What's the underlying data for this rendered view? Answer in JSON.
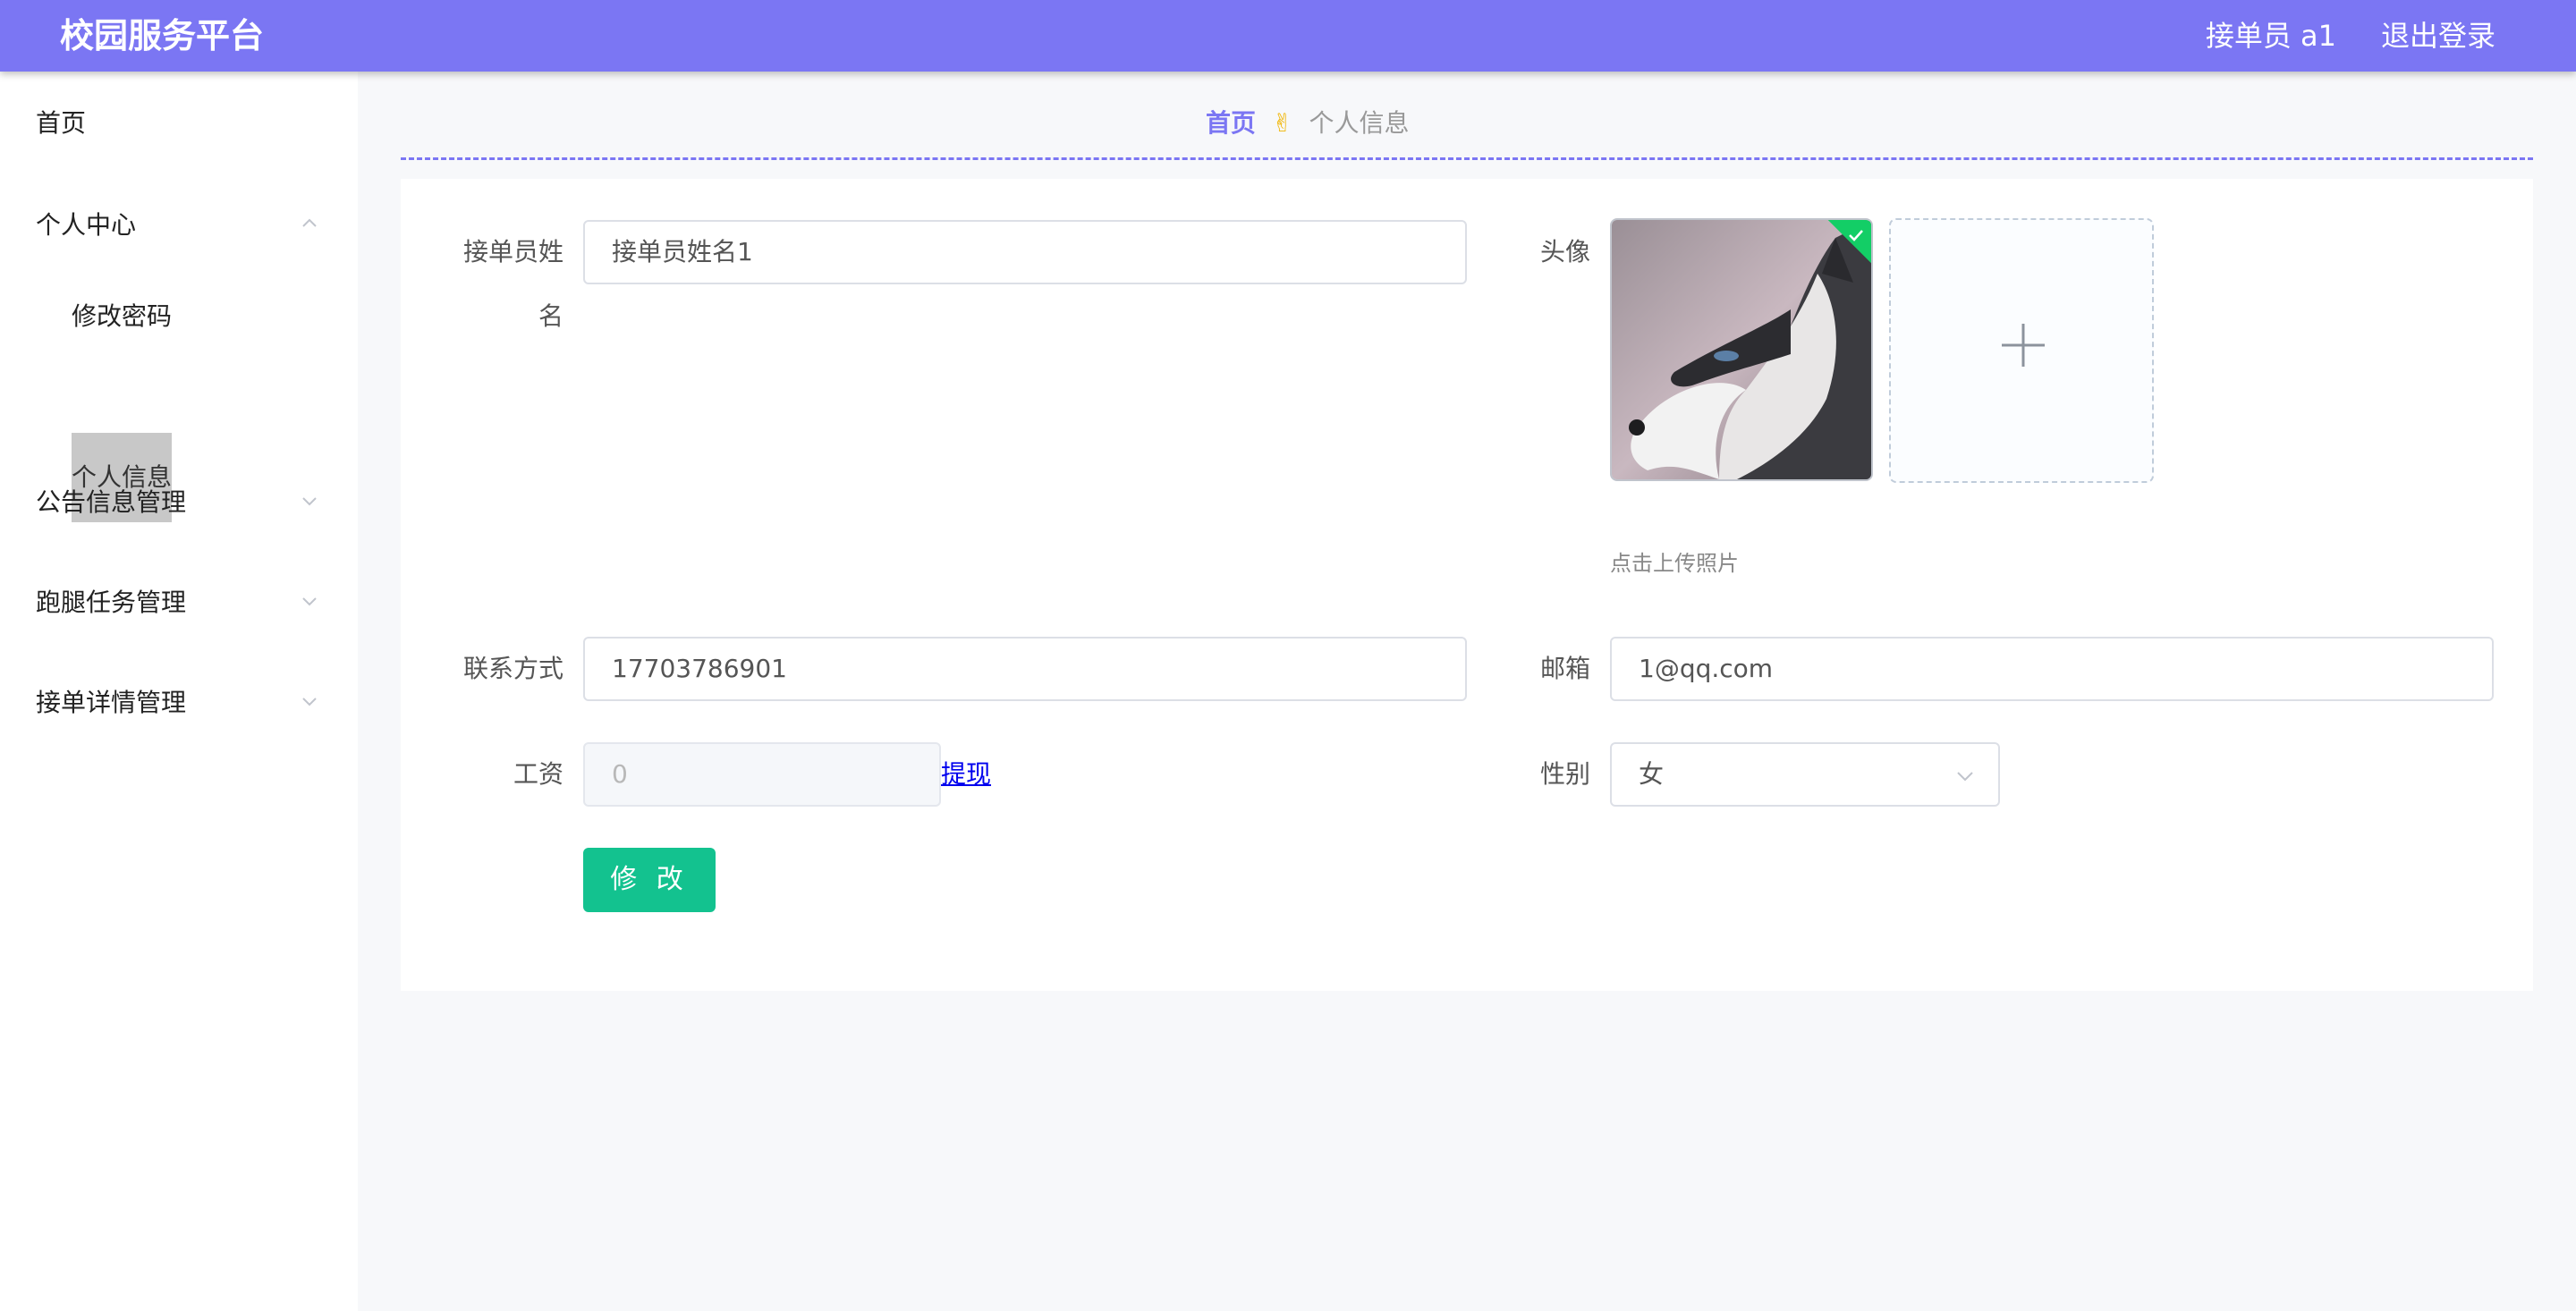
{
  "header": {
    "brand": "校园服务平台",
    "user_label": "接单员 a1",
    "logout_label": "退出登录"
  },
  "sidebar": {
    "home": "首页",
    "personal_center": "个人中心",
    "change_password": "修改密码",
    "personal_info": "个人信息",
    "notice_manage": "公告信息管理",
    "errand_manage": "跑腿任务管理",
    "order_detail_manage": "接单详情管理"
  },
  "breadcrumb": {
    "home": "首页",
    "separator": "✌",
    "current": "个人信息"
  },
  "form": {
    "name_label_line1": "接单员姓",
    "name_label_line2": "名",
    "name_value": "接单员姓名1",
    "avatar_label": "头像",
    "upload_tip": "点击上传照片",
    "contact_label": "联系方式",
    "contact_value": "17703786901",
    "email_label": "邮箱",
    "email_value": "1@qq.com",
    "salary_label": "工资",
    "salary_value": "0",
    "withdraw_label": "提现",
    "gender_label": "性别",
    "gender_value": "女",
    "submit_label": "修 改"
  },
  "colors": {
    "header_bg": "#7b76f3",
    "accent": "#7b76f3",
    "button_bg": "#13c28f",
    "success_badge": "#13ce66"
  }
}
